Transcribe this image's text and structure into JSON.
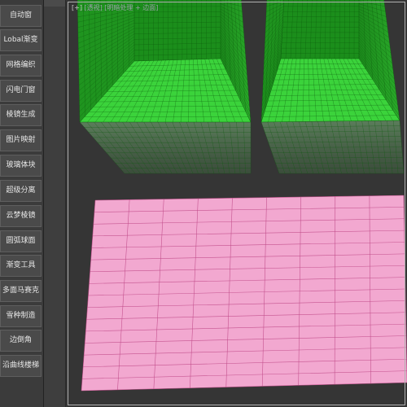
{
  "sidebar": {
    "items": [
      {
        "label": "自动窗"
      },
      {
        "label": "Lobal渐变"
      },
      {
        "label": "网格编织"
      },
      {
        "label": "闪电门窗"
      },
      {
        "label": "棱镜生成"
      },
      {
        "label": "图片映射"
      },
      {
        "label": "玻璃体块"
      },
      {
        "label": "超级分离"
      },
      {
        "label": "云梦棱镜"
      },
      {
        "label": "圆弧球面"
      },
      {
        "label": "渐变工具"
      },
      {
        "label": "多面马赛克"
      },
      {
        "label": "雪种制造"
      },
      {
        "label": "边倒角"
      },
      {
        "label": "沿曲线楼梯"
      }
    ]
  },
  "viewport": {
    "label_plus": "[+]",
    "label_view": "[透视]",
    "label_shading": "[明暗处理 + 边面]"
  },
  "colors": {
    "box_green": "#1f9b1f",
    "box_floor": "#3ad83a",
    "plane_pink": "#f2a8d0",
    "wire": "#5a8a2a",
    "plane_wire": "#c0508a"
  }
}
